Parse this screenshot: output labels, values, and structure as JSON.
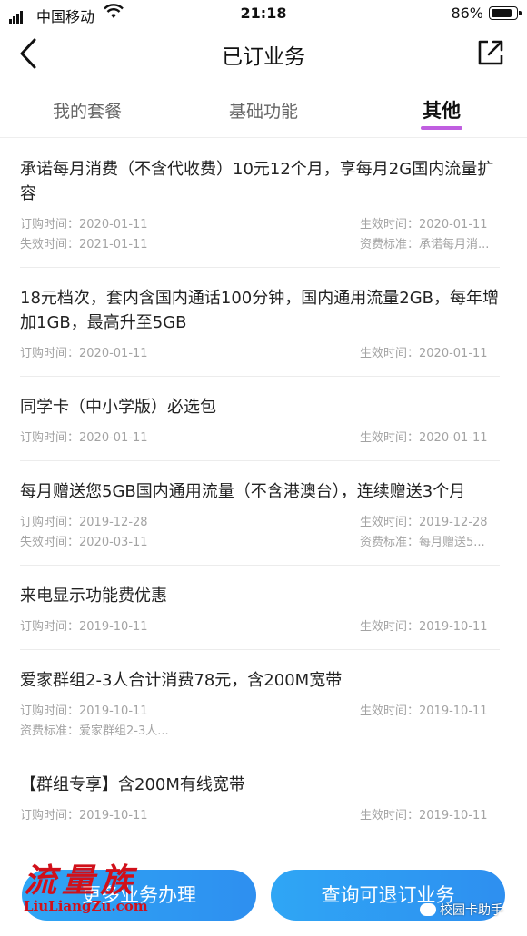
{
  "status_bar": {
    "carrier": "中国移动",
    "time": "21:18",
    "battery_text": "86%",
    "battery_level": 0.86
  },
  "nav": {
    "title": "已订业务",
    "back_icon": "chevron-left-icon",
    "share_icon": "share-external-icon"
  },
  "tabs": [
    {
      "label": "我的套餐",
      "active": false
    },
    {
      "label": "基础功能",
      "active": false
    },
    {
      "label": "其他",
      "active": true
    }
  ],
  "accent_color": "#c05ee0",
  "button_color": "#2e9bf2",
  "services": [
    {
      "name": "承诺每月消费（不含代收费）10元12个月，享每月2G国内流量扩容",
      "order_label": "订购时间：",
      "order_date": "2020-01-11",
      "effective_label": "生效时间：",
      "effective_date": "2020-01-11",
      "expire_label": "失效时间：",
      "expire_date": "2021-01-11",
      "tariff_label": "资费标准：",
      "tariff": "承诺每月消..."
    },
    {
      "name": "18元档次，套内含国内通话100分钟，国内通用流量2GB，每年增加1GB，最高升至5GB",
      "order_label": "订购时间：",
      "order_date": "2020-01-11",
      "effective_label": "生效时间：",
      "effective_date": "2020-01-11"
    },
    {
      "name": "同学卡（中小学版）必选包",
      "order_label": "订购时间：",
      "order_date": "2020-01-11",
      "effective_label": "生效时间：",
      "effective_date": "2020-01-11"
    },
    {
      "name": "每月赠送您5GB国内通用流量（不含港澳台），连续赠送3个月",
      "order_label": "订购时间：",
      "order_date": "2019-12-28",
      "effective_label": "生效时间：",
      "effective_date": "2019-12-28",
      "expire_label": "失效时间：",
      "expire_date": "2020-03-11",
      "tariff_label": "资费标准：",
      "tariff": "每月赠送5..."
    },
    {
      "name": "来电显示功能费优惠",
      "order_label": "订购时间：",
      "order_date": "2019-10-11",
      "effective_label": "生效时间：",
      "effective_date": "2019-10-11"
    },
    {
      "name": "爱家群组2-3人合计消费78元，含200M宽带",
      "order_label": "订购时间：",
      "order_date": "2019-10-11",
      "effective_label": "生效时间：",
      "effective_date": "2019-10-11",
      "tariff_label": "资费标准：",
      "tariff_left": "爱家群组2-3人..."
    },
    {
      "name": "【群组专享】含200M有线宽带",
      "order_label": "订购时间：",
      "order_date": "2019-10-11",
      "effective_label": "生效时间：",
      "effective_date": "2019-10-11"
    }
  ],
  "bottom": {
    "more_label": "更多业务办理",
    "refund_label": "查询可退订业务"
  },
  "watermarks": {
    "logo_cn": "流量族",
    "logo_en": "LiuLiangZu.com",
    "wechat": "校园卡助手"
  }
}
